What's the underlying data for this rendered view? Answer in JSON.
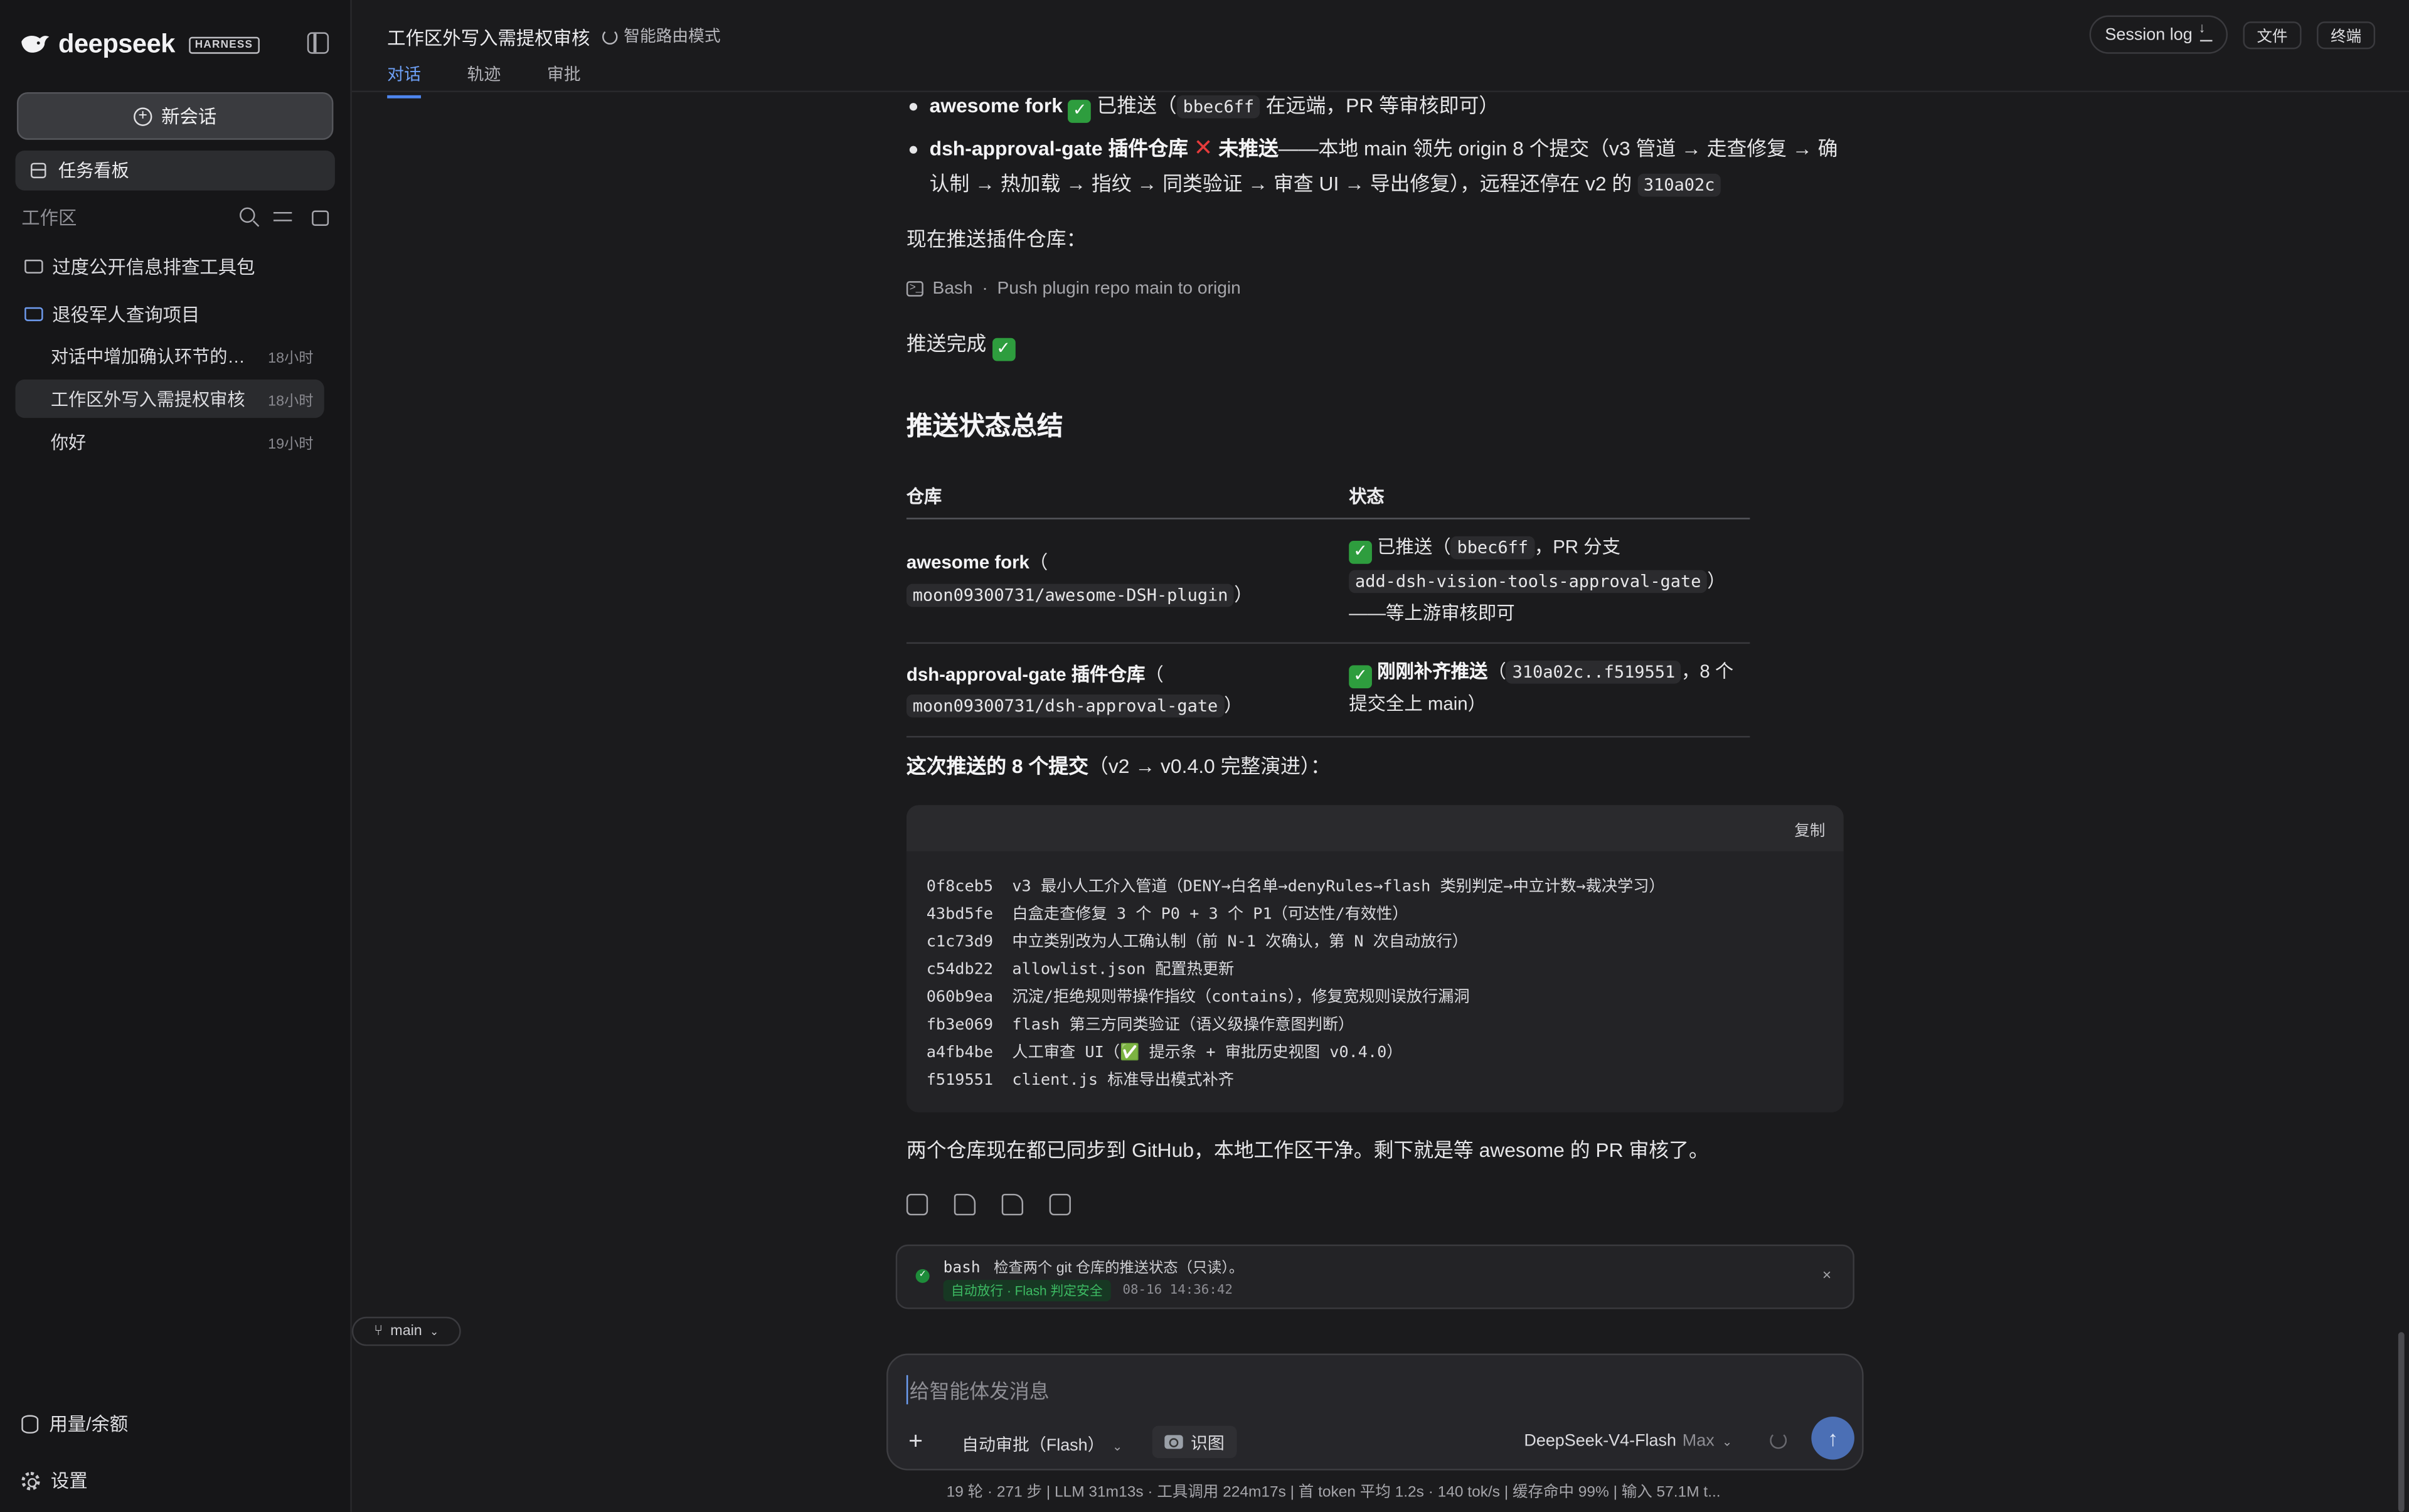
{
  "app": {
    "logo_text": "deepseek",
    "logo_badge": "HARNESS"
  },
  "sidebar": {
    "new_chat": "新会话",
    "task_board": "任务看板",
    "workspace_label": "工作区",
    "folders": [
      {
        "name": "过度公开信息排查工具包"
      },
      {
        "name": "退役军人查询项目"
      }
    ],
    "sessions": [
      {
        "title": "对话中增加确认环节的插...",
        "time": "18小时"
      },
      {
        "title": "工作区外写入需提权审核",
        "time": "18小时"
      },
      {
        "title": "你好",
        "time": "19小时"
      }
    ],
    "usage": "用量/余额",
    "settings": "设置"
  },
  "topbar": {
    "title": "工作区外写入需提权审核",
    "route_mode": "智能路由模式",
    "tabs": [
      "对话",
      "轨迹",
      "审批"
    ],
    "session_log": "Session log",
    "files": "文件",
    "terminal": "终端"
  },
  "messages": {
    "b1_name": "awesome fork",
    "b1_text": " 已推送（",
    "b1_code": "bbec6ff",
    "b1_tail": " 在远端，PR 等审核即可）",
    "b2_name": "dsh-approval-gate 插件仓库",
    "b2_status": " 未推送",
    "b2_text": "——本地 main 领先 origin 8 个提交（v3 管道 → 走查修复 → 确认制 → 热加载 → 指纹 → 同类验证 → 审查 UI → 导出修复），远程还停在 v2 的 ",
    "b2_code": "310a02c",
    "push_now": "现在推送插件仓库：",
    "tool_name": "Bash",
    "tool_desc": "Push plugin repo main to origin",
    "push_done": "推送完成 ",
    "heading": "推送状态总结",
    "commits_intro_bold": "这次推送的 8 个提交",
    "commits_intro_rest": "（v2 → v0.4.0 完整演进）：",
    "closing": "两个仓库现在都已同步到 GitHub，本地工作区干净。剩下就是等 awesome 的 PR 审核了。"
  },
  "table": {
    "headers": [
      "仓库",
      "状态"
    ],
    "rows": [
      {
        "repo_name": "awesome fork",
        "repo_open": "（",
        "repo_path": "moon09300731/awesome-DSH-plugin",
        "repo_close": "）",
        "status_a": " 已推送（",
        "status_code": "bbec6ff",
        "status_b": "，PR 分支 ",
        "status_code2": "add-dsh-vision-tools-approval-gate",
        "status_c": "）——等上游审核即可"
      },
      {
        "repo_name": "dsh-approval-gate 插件仓库",
        "repo_open": "（",
        "repo_path": "moon09300731/dsh-approval-gate",
        "repo_close": "）",
        "status_bold": " 刚刚补齐推送",
        "status_a": "（",
        "status_code": "310a02c..f519551",
        "status_b": "，8 个提交全上 main）"
      }
    ]
  },
  "codeblock": {
    "copy_label": "复制",
    "lines": [
      "0f8ceb5  v3 最小人工介入管道（DENY→白名单→denyRules→flash 类别判定→中立计数→裁决学习）",
      "43bd5fe  白盒走查修复 3 个 P0 + 3 个 P1（可达性/有效性）",
      "c1c73d9  中立类别改为人工确认制（前 N-1 次确认，第 N 次自动放行）",
      "c54db22  allowlist.json 配置热更新",
      "060b9ea  沉淀/拒绝规则带操作指纹（contains），修复宽规则误放行漏洞",
      "fb3e069  flash 第三方同类验证（语义级操作意图判断）",
      "a4fb4be  人工审查 UI（✅ 提示条 + 审批历史视图 v0.4.0）",
      "f519551  client.js 标准导出模式补齐"
    ]
  },
  "tool_card": {
    "command": "bash",
    "description": "检查两个 git 仓库的推送状态（只读）。",
    "badge": "自动放行 · Flash 判定安全",
    "timestamp": "08-16 14:36:42"
  },
  "branch": "main",
  "composer": {
    "placeholder": "给智能体发消息",
    "approval_mode": "自动审批（Flash）",
    "vision": "识图",
    "model": "DeepSeek-V4-Flash",
    "model_tier": "Max"
  },
  "status_bar": "19 轮 · 271 步  |  LLM 31m13s · 工具调用 224m17s  |  首 token 平均 1.2s · 140 tok/s  |  缓存命中 99%  |  输入 57.1M t...",
  "colors": {
    "accent": "#4e86ef",
    "success": "#2e9d3e",
    "error": "#e53b3b"
  }
}
